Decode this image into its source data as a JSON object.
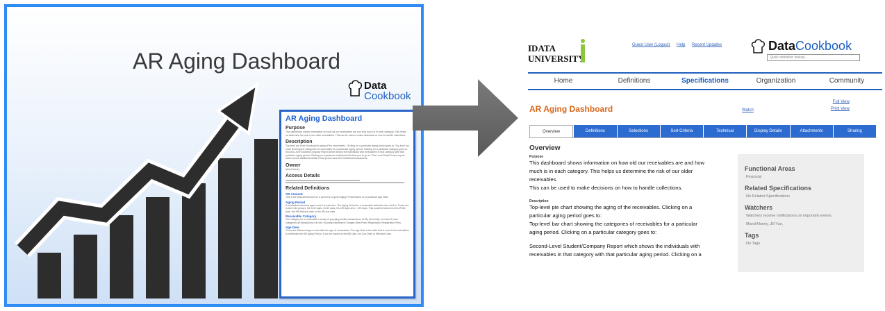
{
  "left": {
    "title": "AR Aging Dashboard",
    "logo": {
      "line1": "Data",
      "line2": "Cookbook"
    },
    "doc": {
      "title": "AR Aging Dashboard",
      "purpose_heading": "Purpose",
      "purpose_text": "This dashboard shows information on how old our receivables are and how much is in each category. This helps us determine the risk of our older receivables. This can be used to make decisions on how to handle collections.",
      "description_heading": "Description",
      "description_text": "Top-level pie chart showing the aging of the receivables. Clicking on a particular aging period goes to: Top-level bar chart showing the categories of receivables for a particular aging period. Clicking on a particular category goes to: Second-Level Student/Company Report which shows the individuals with receivables in that category with that particular aging period. Clicking on a particular individual will allow you to go to: This Level Detail Person report which shows additional detail of that person and their individual transactions.",
      "owner_heading": "Owner",
      "owner_text": "Mand Money",
      "access_heading": "Access Details",
      "related_heading": "Related Definitions",
      "related": [
        {
          "name": "AR Amount",
          "text": "This is the total AR Amount for a person in a given Aging Period based on a particular Age Date."
        },
        {
          "name": "Aging Period",
          "text": "A receivable becomes aged once it is past due. The Aging Period for a receivable indicates how old it is. These are broken into groups, the 0-30 days, 31-60 days, 61-120 days and > 120 days. This could be based on the AR bill date, the AR effective date or the AR due date."
        },
        {
          "name": "Receivable Category",
          "text": "The category for a receivable is a way of grouping similar transactions. At My University, we have 5 main categories all transactions roll into: Housing Installment Charges Meal Plans Registration Registration Fees"
        },
        {
          "name": "Age Date",
          "text": "There are different ways to calculate the age of receivables. The Age Date is the date that is used in the calculation to determine the AR Aging Period. It can be based on the Bill Date, the Due Date or Effective Date."
        }
      ]
    }
  },
  "right": {
    "university_line1": "IDATA",
    "university_line2": "UNIVERSITY",
    "top_links": [
      "Guest User (Logout)",
      "Help",
      "Recent Updates"
    ],
    "datacookbook": {
      "part1": "Data",
      "part2": "Cookbook",
      "search_placeholder": "Quick definition lookup..."
    },
    "nav": [
      "Home",
      "Definitions",
      "Specifications",
      "Organization",
      "Community"
    ],
    "nav_active": "Specifications",
    "page_title": "AR Aging Dashboard",
    "watch": "Watch",
    "full_view": "Full View",
    "print_view": "Print View",
    "tabs": [
      "Overview",
      "Definitions",
      "Selections",
      "Sort Criteria",
      "Technical",
      "Display Details",
      "Attachments",
      "Sharing"
    ],
    "active_tab": "Overview",
    "overview": {
      "heading": "Overview",
      "purpose_label": "Purpose",
      "purpose_lines": [
        "This dashboard shows information on how old our receivables are and how",
        "much is in each category. This helps us determine the risk of our older",
        "receivables.",
        "This can be used to make decisions on how to handle collections."
      ],
      "description_label": "Description",
      "description_lines": [
        "Top-level pie chart showing the aging of the receivables. Clicking on a",
        "particular aging period goes to:",
        "Top-level bar chart showing the categories of receivables for a particular",
        "aging period. Clicking on a particular category goes to:"
      ],
      "description_lines_2": [
        "Second-Level Student/Company Report which shows the individuals with",
        "receivables in that category with that particular aging period. Clicking on a"
      ]
    },
    "sidebar": {
      "functional_areas": "Functional Areas",
      "functional_value": "Financial",
      "related_specs": "Related Specifications",
      "related_specs_value": "No Related Specifications",
      "watchers": "Watchers",
      "watchers_value": "Watchers receive notifications on important events.",
      "watchers_names": "Mand Money, Jill Yun,",
      "tags": "Tags",
      "tags_value": "No Tags"
    }
  },
  "colors": {
    "accent_blue": "#2f8cf5",
    "nav_blue": "#1e5fbf",
    "title_orange": "#d9661a",
    "chart_dark": "#2d2d2d"
  }
}
